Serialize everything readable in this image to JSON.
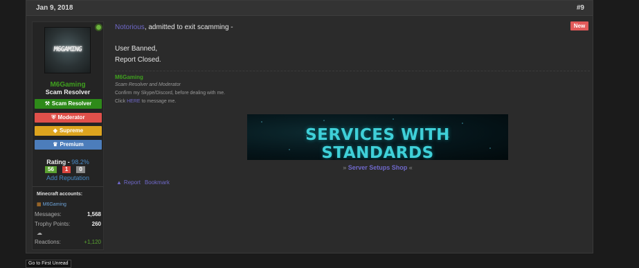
{
  "post": {
    "date": "Jan 9, 2018",
    "number": "#9"
  },
  "user": {
    "avatar_text": "M6GAMING",
    "name": "M6Gaming",
    "title": "Scam Resolver",
    "badges": {
      "scam": "Scam Resolver",
      "moderator": "Moderator",
      "supreme": "Supreme",
      "premium": "Premium"
    },
    "rating_label": "Rating - ",
    "rating_value": "98.2%",
    "rating_pos": "56",
    "rating_neg": "1",
    "rating_neu": "0",
    "add_reputation": "Add Reputation",
    "mc_label": "Minecraft accounts:",
    "mc_account": "M6Gaming",
    "stats": {
      "messages_label": "Messages:",
      "messages": "1,568",
      "trophy_label": "Trophy Points:",
      "trophy": "260",
      "reactions_label": "Reactions:",
      "reactions": "+1,120"
    }
  },
  "message": {
    "mention": "Notorious",
    "line1_rest": ", admitted to exit scamming -",
    "line2": "User Banned,",
    "line3": "Report Closed.",
    "new_badge": "New"
  },
  "signature": {
    "name": "M6Gaming",
    "role": "Scam Resolver and Moderator",
    "confirm": "Confirm my Skype/Discord, before dealing with me.",
    "click_pre": "Click ",
    "click_here": "HERE",
    "click_post": " to message me.",
    "banner_text": "SERVICES WITH STANDARDS",
    "shop_prefix": "» ",
    "shop_link": "Server Setups Shop",
    "shop_suffix": " «"
  },
  "actions": {
    "report": "Report",
    "bookmark": "Bookmark"
  },
  "footer": {
    "first_unread": "Go to First Unread"
  },
  "colors": {
    "accent_link": "#6f68c9",
    "user_green": "#3fa01e",
    "new_badge": "#e25a5a"
  }
}
